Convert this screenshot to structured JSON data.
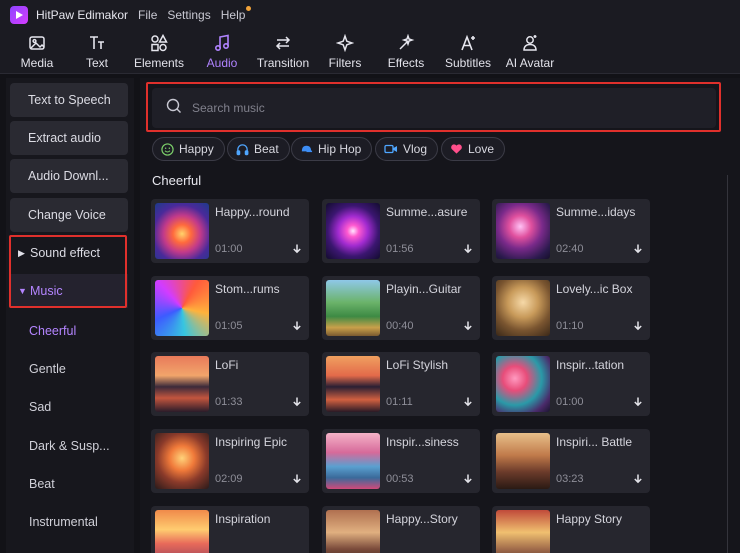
{
  "app": {
    "title": "HitPaw Edimakor",
    "brand_color": "#a45bff"
  },
  "menu": [
    {
      "label": "File"
    },
    {
      "label": "Settings"
    },
    {
      "label": "Help"
    }
  ],
  "toolbar": {
    "active": "Audio",
    "tabs": [
      {
        "label": "Media",
        "icon": "image-icon"
      },
      {
        "label": "Text",
        "icon": "text-icon"
      },
      {
        "label": "Elements",
        "icon": "elements-icon"
      },
      {
        "label": "Audio",
        "icon": "music-note-icon"
      },
      {
        "label": "Transition",
        "icon": "transition-arrows-icon"
      },
      {
        "label": "Filters",
        "icon": "sparkle-icon"
      },
      {
        "label": "Effects",
        "icon": "effects-icon"
      },
      {
        "label": "Subtitles",
        "icon": "subtitles-icon"
      },
      {
        "label": "AI Avatar",
        "icon": "avatar-icon"
      }
    ]
  },
  "sidebar": {
    "tools": [
      {
        "label": "Text to Speech"
      },
      {
        "label": "Extract audio"
      },
      {
        "label": "Audio Downl..."
      },
      {
        "label": "Change Voice"
      }
    ],
    "categories": [
      {
        "label": "Sound effect",
        "expanded": false
      },
      {
        "label": "Music",
        "expanded": true
      }
    ],
    "subcategories": [
      {
        "label": "Cheerful",
        "active": true
      },
      {
        "label": "Gentle"
      },
      {
        "label": "Sad"
      },
      {
        "label": "Dark & Susp..."
      },
      {
        "label": "Beat"
      },
      {
        "label": "Instrumental"
      }
    ]
  },
  "search": {
    "placeholder": "Search music",
    "value": ""
  },
  "tags": [
    {
      "label": "Happy",
      "icon": "smile-icon"
    },
    {
      "label": "Beat",
      "icon": "headphones-icon"
    },
    {
      "label": "Hip Hop",
      "icon": "cap-icon"
    },
    {
      "label": "Vlog",
      "icon": "video-camera-icon"
    },
    {
      "label": "Love",
      "icon": "heart-icon"
    }
  ],
  "section": {
    "title": "Cheerful"
  },
  "tracks": [
    {
      "title": "Happy...round",
      "duration": "01:00"
    },
    {
      "title": "Summe...asure",
      "duration": "01:56"
    },
    {
      "title": "Summe...idays",
      "duration": "02:40"
    },
    {
      "title": "Stom...rums",
      "duration": "01:05"
    },
    {
      "title": "Playin...Guitar",
      "duration": "00:40"
    },
    {
      "title": "Lovely...ic Box",
      "duration": "01:10"
    },
    {
      "title": "LoFi",
      "duration": "01:33"
    },
    {
      "title": "LoFi Stylish",
      "duration": "01:11"
    },
    {
      "title": "Inspir...tation",
      "duration": "01:00"
    },
    {
      "title": "Inspiring Epic",
      "duration": "02:09"
    },
    {
      "title": "Inspir...siness",
      "duration": "00:53"
    },
    {
      "title": "Inspiri... Battle",
      "duration": "03:23"
    },
    {
      "title": "Inspiration",
      "duration": ""
    },
    {
      "title": "Happy...Story",
      "duration": ""
    },
    {
      "title": "Happy Story",
      "duration": ""
    }
  ]
}
